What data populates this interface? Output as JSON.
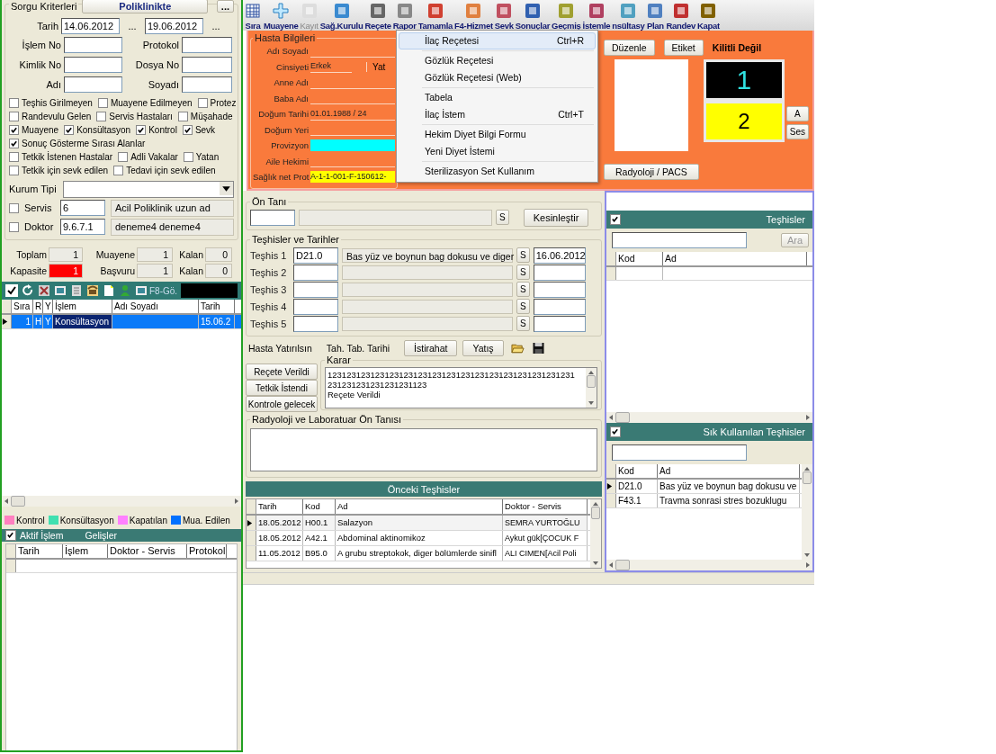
{
  "query": {
    "title": "Sorgu Kriterleri",
    "status_button": "Poliklinikte",
    "more_button": "...",
    "date": {
      "label": "Tarih",
      "from": "14.06.2012",
      "from_picker": "...",
      "to": "19.06.2012",
      "to_picker": "..."
    },
    "fields": [
      {
        "label": "İşlem No"
      },
      {
        "label": "Protokol"
      },
      {
        "label": "Kimlik No"
      },
      {
        "label": "Dosya No"
      },
      {
        "label": "Adı"
      },
      {
        "label": "Soyadı"
      }
    ],
    "filters": [
      [
        {
          "label": "Teşhis Girilmeyen",
          "checked": false
        },
        {
          "label": "Muayene Edilmeyen",
          "checked": false
        },
        {
          "label": "Protez",
          "checked": false
        }
      ],
      [
        {
          "label": "Randevulu Gelen",
          "checked": false
        },
        {
          "label": "Servis Hastaları",
          "checked": false
        },
        {
          "label": "Müşahade",
          "checked": false
        }
      ],
      [
        {
          "label": "Muayene",
          "checked": true
        },
        {
          "label": "Konsültasyon",
          "checked": true
        },
        {
          "label": "Kontrol",
          "checked": true
        },
        {
          "label": "Sevk",
          "checked": true
        }
      ],
      [
        {
          "label": "Sonuç Gösterme Sırası Alanlar",
          "checked": true
        }
      ],
      [
        {
          "label": "Tetkik İstenen Hastalar",
          "checked": false
        },
        {
          "label": "Adli Vakalar",
          "checked": false
        },
        {
          "label": "Yatan",
          "checked": false
        }
      ],
      [
        {
          "label": "Tetkik için sevk edilen",
          "checked": false
        },
        {
          "label": "Tedavi için sevk edilen",
          "checked": false
        }
      ]
    ],
    "institution": {
      "label": "Kurum Tipi"
    },
    "pickers": [
      {
        "label": "Servis",
        "checked": false,
        "code": "6",
        "name": "Acil Poliklinik uzun ad"
      },
      {
        "label": "Doktor",
        "checked": false,
        "code": "9.6.7.1",
        "name": "deneme4 deneme4"
      }
    ]
  },
  "stats": [
    {
      "label": "Toplam",
      "value": "1",
      "alert": false
    },
    {
      "label": "Muayene",
      "value": "1",
      "alert": false
    },
    {
      "label": "Kalan",
      "value": "0",
      "alert": false
    },
    {
      "label": "Kapasite",
      "value": "1",
      "alert": true
    },
    {
      "label": "Başvuru",
      "value": "1",
      "alert": false
    },
    {
      "label": "Kalan",
      "value": "0",
      "alert": false
    }
  ],
  "patient_toolbar": {
    "label": "F8-Gö."
  },
  "patient_list": {
    "columns": [
      "Sıra",
      "R",
      "Y",
      "İşlem",
      "Adı Soyadı",
      "Tarih"
    ],
    "rows": [
      {
        "sira": "1",
        "r": "H",
        "y": "Y",
        "islem": "Konsültasyon",
        "tarih": "15.06.2",
        "selected": true
      }
    ]
  },
  "legend": [
    {
      "label": "Kontrol",
      "color": "#ff80c0"
    },
    {
      "label": "Konsültasyon",
      "color": "#40e0b0"
    },
    {
      "label": "Kapatılan",
      "color": "#ff80ff"
    },
    {
      "label": "Mua. Edilen",
      "color": "#0070ff"
    }
  ],
  "active": {
    "label": "Aktif İşlem",
    "checked": true,
    "title": "Gelişler",
    "columns": [
      "Tarih",
      "İşlem",
      "Doktor - Servis",
      "Protokol"
    ]
  },
  "toolbar": [
    {
      "label": "Sıra",
      "disabled": false
    },
    {
      "label": "Muayene",
      "disabled": false
    },
    {
      "label": "Kayıt",
      "disabled": true
    },
    {
      "label": "Sağ.Kurulu",
      "disabled": false
    },
    {
      "label": "Reçete",
      "disabled": false
    },
    {
      "label": "Rapor",
      "disabled": false
    },
    {
      "label": "Tamamla",
      "disabled": false
    },
    {
      "label": "F4-Hizmet",
      "disabled": false
    },
    {
      "label": "Sevk",
      "disabled": false
    },
    {
      "label": "Sonuçlar",
      "disabled": false
    },
    {
      "label": "Geçmiş",
      "disabled": false
    },
    {
      "label": "İstemle",
      "disabled": false
    },
    {
      "label": "nsültasy",
      "disabled": false
    },
    {
      "label": "Plan",
      "disabled": false
    },
    {
      "label": "Randev",
      "disabled": false
    },
    {
      "label": "Kapat",
      "disabled": false
    }
  ],
  "patient": {
    "title": "Hasta Bilgileri",
    "fields": [
      {
        "label": "Adı Soyadı"
      },
      {
        "label": "Cinsiyeti",
        "value": "Erkek",
        "extra": "Yat"
      },
      {
        "label": "Anne Adı"
      },
      {
        "label": "Baba Adı"
      },
      {
        "label": "Doğum Tarihi",
        "value": "01.01.1988 / 24"
      },
      {
        "label": "Doğum Yeri"
      },
      {
        "label": "Provizyon",
        "color": "#00ffff"
      },
      {
        "label": "Aile Hekimi"
      },
      {
        "label": "Sağlık net Prot",
        "value": "A-1-1-001-F-150612-",
        "color": "#ffff00"
      }
    ]
  },
  "menu": [
    [
      {
        "label": "İlaç Reçetesi",
        "shortcut": "Ctrl+R",
        "selected": true
      }
    ],
    [
      {
        "label": "Gözlük Reçetesi",
        "selected": false
      },
      {
        "label": "Gözlük Reçetesi (Web)",
        "selected": false
      }
    ],
    [
      {
        "label": "Tabela",
        "selected": false
      },
      {
        "label": "İlaç İstem",
        "shortcut": "Ctrl+T",
        "selected": false
      }
    ],
    [
      {
        "label": "Hekim Diyet Bilgi Formu",
        "selected": false
      },
      {
        "label": "Yeni Diyet İstemi",
        "selected": false
      }
    ],
    [
      {
        "label": "Sterilizasyon Set Kullanım",
        "selected": false
      }
    ]
  ],
  "card": {
    "buttons": [
      "Düzenle",
      "Etiket"
    ],
    "lock_status": "Kilitli Değil",
    "current": "1",
    "next": "2",
    "side_buttons": [
      "A",
      "Ses"
    ],
    "pacs_button": "Radyoloji / PACS"
  },
  "pre_diagnosis": {
    "title": "Ön Tanı",
    "s_button": "S",
    "confirm_button": "Kesinleştir"
  },
  "diagnoses": {
    "title": "Teşhisler ve Tarihler",
    "rows": [
      {
        "label": "Teşhis 1",
        "code": "D21.0",
        "name": "Bas yüz ve boynun bag dokusu ve diger",
        "s": "S",
        "date": "16.06.2012"
      },
      {
        "label": "Teşhis 2",
        "s": "S"
      },
      {
        "label": "Teşhis 3",
        "s": "S"
      },
      {
        "label": "Teşhis 4",
        "s": "S"
      },
      {
        "label": "Teşhis 5",
        "s": "S"
      }
    ]
  },
  "actions": {
    "texts": [
      "Hasta Yatırılsın",
      "Tah. Tab. Tarihi"
    ],
    "buttons": [
      "İstirahat",
      "Yatış"
    ]
  },
  "side_buttons": [
    "Reçete Verildi",
    "Tetkik İstendi",
    "Kontrole gelecek"
  ],
  "decision": {
    "title": "Karar",
    "lines": [
      "1231231231231231231231231231231231231231231231231231",
      "231231231231231231123",
      "Reçete Verildi"
    ]
  },
  "radiology": {
    "title": "Radyoloji ve Laboratuar Ön Tanısı"
  },
  "previous": {
    "title": "Önceki Teşhisler",
    "columns": [
      "Tarih",
      "Kod",
      "Ad",
      "Doktor - Servis"
    ],
    "rows": [
      {
        "cells": [
          "18.05.2012",
          "H00.1",
          "Salazyon",
          "SEMRA YURTOĞLU"
        ],
        "selected": true
      },
      {
        "cells": [
          "18.05.2012",
          "A42.1",
          "Abdominal aktinomikoz",
          "Aykut gük[ÇOCUK F"
        ],
        "selected": false
      },
      {
        "cells": [
          "11.05.2012",
          "B95.0",
          "A grubu streptokok, diger bölümlerde sinifl",
          "ALI CIMEN[Acil Poli"
        ],
        "selected": false
      }
    ]
  },
  "diagnosis_search": {
    "title": "Teşhisler",
    "checked": true,
    "search_button": "Ara",
    "columns": [
      "Kod",
      "Ad"
    ]
  },
  "frequent": {
    "title": "Sık Kullanılan Teşhisler",
    "checked": true,
    "columns": [
      "Kod",
      "Ad"
    ],
    "rows": [
      {
        "code": "D21.0",
        "name": "Bas yüz ve boynun bag dokusu ve",
        "selected": true
      },
      {
        "code": "F43.1",
        "name": "Travma sonrasi stres bozuklugu",
        "selected": false
      }
    ]
  }
}
